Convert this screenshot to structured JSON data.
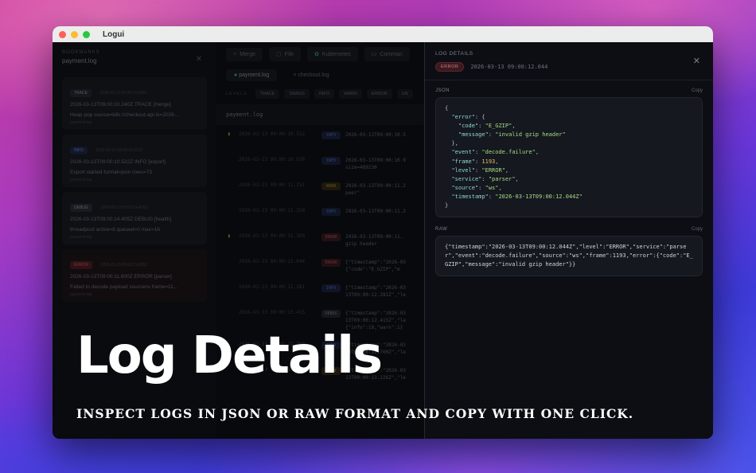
{
  "window": {
    "title": "Logui"
  },
  "sidebar": {
    "section_label": "BOOKMARKS",
    "file": "payment.log",
    "bookmarks": [
      {
        "level": "TRACE",
        "time": "2026-03-13 00:00:10.2402",
        "text": "2026-03-13T09:00:10.240Z TRACE [merge]",
        "sub": "Heap pop source=k8s://checkout-api ts=2026-...",
        "src": "payment.log"
      },
      {
        "level": "INFO",
        "time": "2026-03-13 09:00:10.5222",
        "text": "2026-03-13T09:00:10.522Z INFO [export]",
        "sub": "Export started format=json rows=73",
        "src": "payment.log"
      },
      {
        "level": "DEBUG",
        "time": "2026-03-13 09:00:14.4052",
        "text": "2026-03-13T09:00:14.405Z DEBUG [health]",
        "sub": "threadpool active=8 queued=0 max=16",
        "src": "payment.log"
      },
      {
        "level": "ERROR",
        "time": "2026-03-13 09:00:11.800Z",
        "text": "2026-03-13T09:00:11.800Z ERROR [parser]",
        "sub": "Failed to decode payload sourcens frame=11...",
        "src": "payment.log"
      }
    ]
  },
  "toolbar": {
    "merge": "Merge",
    "file": "File",
    "kubernetes": "Kubernetes",
    "commands": "Comman"
  },
  "tabs": [
    {
      "label": "payment.log"
    },
    {
      "label": "checkout.log"
    }
  ],
  "levels": {
    "label": "LEVELS",
    "items": [
      "TRACE",
      "DEBUG",
      "INFO",
      "WARN",
      "ERROR",
      "UN"
    ]
  },
  "file_header": "payment.log",
  "rows": [
    {
      "star": "▮",
      "ts": "2026-03-13 09:00:10.522",
      "level": "INFO",
      "msg": "2026-03-13T09:00:10.5"
    },
    {
      "star": "",
      "ts": "2026-03-13 09:00:10.938",
      "level": "INFO",
      "msg": "2026-03-13T09:00:10.9\nsize=489230"
    },
    {
      "star": "",
      "ts": "2026-03-13 09:00:11.251",
      "level": "WARN",
      "msg": "2026-03-13T09:00:11.2\npeer\""
    },
    {
      "star": "",
      "ts": "2026-03-13 09:00:11.258",
      "level": "INFO",
      "msg": "2026-03-13T09:00:11.2"
    },
    {
      "star": "▮",
      "ts": "2026-03-13 09:00:11.300",
      "level": "ERROR",
      "msg": "2026-03-13T09:00:11.\ngzip header"
    },
    {
      "star": "",
      "ts": "2026-03-13 09:00:12.044",
      "level": "ERROR",
      "msg": "{\"timestamp\":\"2026-03\n{\"code\":\"E_GZIP\",\"m"
    },
    {
      "star": "",
      "ts": "2026-03-13 09:00:12.281",
      "level": "INFO",
      "msg": "{\"timestamp\":\"2026-03\n13T09:00:12.281Z\",\"le"
    },
    {
      "star": "",
      "ts": "2026-03-13 09:00:13.415",
      "level": "DEBUG",
      "msg": "{\"timestamp\":\"2026-03\n13T09:00:12.415Z\",\"le\n{\"info\":18,\"warn\":1}"
    },
    {
      "star": "",
      "ts": "2026-03-13 09:00:12.700",
      "level": "INFO",
      "msg": "{\"timestamp\":\"2026-03\n13T09:00:12.700Z\",\"le"
    },
    {
      "star": "",
      "ts": "2026-03-13 09:00:13.018",
      "level": "WARN",
      "msg": "{\"timestamp\":\"2026-03\n13T09:00:13.226Z\",\"le"
    }
  ],
  "detail": {
    "title": "LOG DETAILS",
    "level": "ERROR",
    "time": "2026-03-13 09:00:12.044",
    "json_label": "JSON",
    "raw_label": "RAW",
    "copy_label": "Copy",
    "json": {
      "code": "E_GZIP",
      "message": "invalid gzip header",
      "event": "decode.failure",
      "frame": "1193",
      "level": "ERROR",
      "service": "parser",
      "source": "ws",
      "timestamp": "2026-03-13T09:00:12.044Z"
    },
    "raw": "{\"timestamp\":\"2026-03-13T09:00:12.044Z\",\"level\":\"ERROR\",\"service\":\"parser\",\"event\":\"decode.failure\",\"source\":\"ws\",\"frame\":1193,\"error\":{\"code\":\"E_GZIP\",\"message\":\"invalid gzip header\"}}"
  },
  "marketing": {
    "headline": "Log Details",
    "tagline": "INSPECT LOGS IN JSON OR RAW FORMAT AND COPY WITH ONE CLICK."
  }
}
